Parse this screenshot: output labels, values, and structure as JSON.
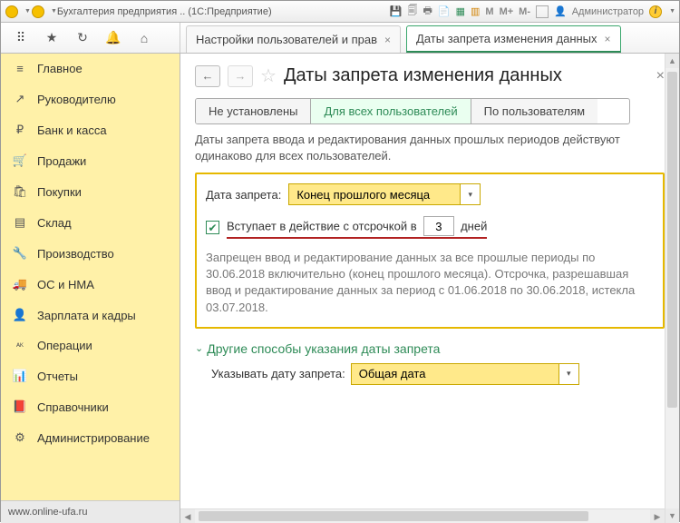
{
  "titlebar": {
    "app_title": "Бухгалтерия предприятия .. (1С:Предприятие)",
    "user": "Администратор",
    "letters": {
      "m": "M",
      "mp": "M+",
      "mm": "M-"
    }
  },
  "tabs": {
    "inactive": "Настройки пользователей и прав",
    "active": "Даты запрета изменения данных"
  },
  "sidebar": {
    "items": [
      {
        "label": "Главное",
        "icon": "≡"
      },
      {
        "label": "Руководителю",
        "icon": "↗"
      },
      {
        "label": "Банк и касса",
        "icon": "₽"
      },
      {
        "label": "Продажи",
        "icon": "🛒"
      },
      {
        "label": "Покупки",
        "icon": "🛍"
      },
      {
        "label": "Склад",
        "icon": "▤"
      },
      {
        "label": "Производство",
        "icon": "🔧"
      },
      {
        "label": "ОС и НМА",
        "icon": "🚚"
      },
      {
        "label": "Зарплата и кадры",
        "icon": "👤"
      },
      {
        "label": "Операции",
        "icon": "ᴬᴷ"
      },
      {
        "label": "Отчеты",
        "icon": "📊"
      },
      {
        "label": "Справочники",
        "icon": "📕"
      },
      {
        "label": "Администрирование",
        "icon": "⚙"
      }
    ],
    "footer": "www.online-ufa.ru"
  },
  "page": {
    "title": "Даты запрета изменения данных",
    "mode_tabs": [
      "Не установлены",
      "Для всех пользователей",
      "По пользователям"
    ],
    "mode_selected": 1,
    "description": "Даты запрета ввода и редактирования данных прошлых периодов действуют одинаково для всех пользователей.",
    "deny_date_label": "Дата запрета:",
    "deny_date_value": "Конец прошлого месяца",
    "delay_label_pre": "Вступает в действие с отсрочкой в",
    "delay_value": "3",
    "delay_label_post": "дней",
    "info": "Запрещен ввод и редактирование данных за все прошлые периоды по 30.06.2018 включительно (конец прошлого месяца). Отсрочка, разрешавшая ввод и редактирование данных за период с 01.06.2018 по 30.06.2018, истекла 03.07.2018.",
    "other_ways": "Другие способы указания даты запрета",
    "show_date_label": "Указывать дату запрета:",
    "show_date_value": "Общая дата"
  }
}
